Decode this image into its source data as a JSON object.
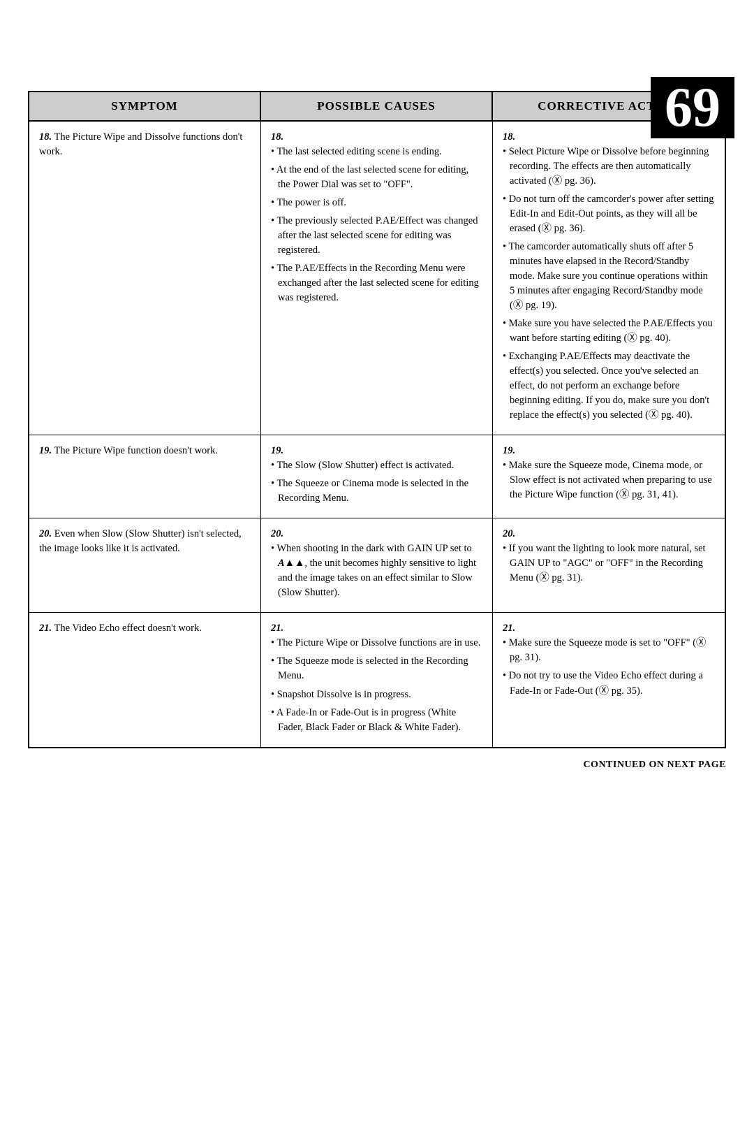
{
  "page": {
    "number": "69"
  },
  "table": {
    "headers": {
      "symptom": "Symptom",
      "causes": "Possible Causes",
      "action": "Corrective Action"
    },
    "rows": [
      {
        "id": "row-18",
        "symptom": {
          "num": "18.",
          "text": "The Picture Wipe and Dissolve functions don't work."
        },
        "causes": {
          "num": "18.",
          "items": [
            "The last selected editing scene is ending.",
            "At the end of the last selected scene for editing, the Power Dial was set to \"OFF\".",
            "The power is off.",
            "The previously selected P.AE/Effect was changed after the last selected scene for editing was registered.",
            "The P.AE/Effects in the Recording Menu were exchanged after the last selected scene for editing was registered."
          ]
        },
        "action": {
          "num": "18.",
          "items": [
            "Select Picture Wipe or Dissolve before beginning recording. The effects are then automatically activated (☞ pg. 36).",
            "Do not turn off the camcorder's power after setting Edit-In and Edit-Out points, as they will all be erased (☞ pg. 36).",
            "The camcorder automatically shuts off after 5 minutes have elapsed in the Record/Standby mode. Make sure you continue operations within 5 minutes after engaging Record/Standby mode (☞ pg. 19).",
            "Make sure you have selected the P.AE/Effects you want before starting editing (☞ pg. 40).",
            "Exchanging P.AE/Effects may deactivate the effect(s) you selected. Once you've selected an effect, do not perform an exchange before beginning editing. If you do, make sure you don't replace the effect(s) you selected (☞ pg. 40)."
          ]
        }
      },
      {
        "id": "row-19",
        "symptom": {
          "num": "19.",
          "text": "The Picture Wipe function doesn't work."
        },
        "causes": {
          "num": "19.",
          "items": [
            "The Slow (Slow Shutter) effect is activated.",
            "The Squeeze or Cinema mode is selected in the Recording Menu."
          ]
        },
        "action": {
          "num": "19.",
          "items": [
            "Make sure the Squeeze mode, Cinema mode, or Slow effect is not activated when preparing to use the Picture Wipe function (☞ pg. 31, 41)."
          ]
        }
      },
      {
        "id": "row-20",
        "symptom": {
          "num": "20.",
          "text": "Even when Slow (Slow Shutter) isn't selected, the image looks like it is activated."
        },
        "causes": {
          "num": "20.",
          "items": [
            "When shooting in the dark with GAIN UP set to AGC▲, the unit becomes highly sensitive to light and the image takes on an effect similar to Slow (Slow Shutter)."
          ]
        },
        "action": {
          "num": "20.",
          "items": [
            "If you want the lighting to look more natural, set GAIN UP to \"AGC\" or \"OFF\" in the Recording Menu (☞ pg. 31)."
          ]
        }
      },
      {
        "id": "row-21",
        "symptom": {
          "num": "21.",
          "text": "The Video Echo effect doesn't work."
        },
        "causes": {
          "num": "21.",
          "items": [
            "The Picture Wipe or Dissolve functions are in use.",
            "The Squeeze mode is selected in the Recording Menu.",
            "Snapshot Dissolve is in progress.",
            "A Fade-In or Fade-Out is in progress (White Fader, Black Fader or Black & White Fader)."
          ]
        },
        "action": {
          "num": "21.",
          "items": [
            "Make sure the Squeeze mode is set to \"OFF\" (☞ pg. 31).",
            "Do not try to use the Video Echo effect during a Fade-In or Fade-Out (☞ pg. 35)."
          ]
        }
      }
    ],
    "footer": "CONTINUED ON NEXT PAGE"
  }
}
